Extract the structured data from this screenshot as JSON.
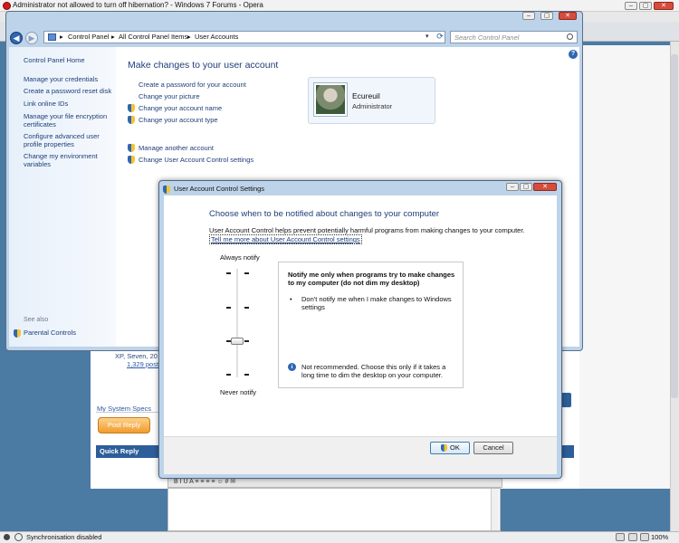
{
  "browser": {
    "title": "Administrator not allowed to turn off hibernation? - Windows 7 Forums - Opera",
    "status_text": "Synchronisation disabled",
    "zoom": "100%",
    "min_glyph": "–",
    "max_glyph": "▢",
    "close_glyph": "✕"
  },
  "forum": {
    "xp_text": "XP, Seven, 20",
    "posts_text": "1,329 post",
    "system_specs": "My System Specs",
    "post_reply": "Post Reply",
    "quick_reply": "Quick Reply",
    "editor_toolbar": "B  I  U  A  ≡ ≡ ≡ ≡  ☺  #  ✉"
  },
  "control_panel": {
    "breadcrumb": [
      "Control Panel",
      "All Control Panel Items",
      "User Accounts"
    ],
    "crumb_separator": "▸",
    "search_placeholder": "Search Control Panel",
    "sidebar_home": "Control Panel Home",
    "sidebar_links": [
      "Manage your credentials",
      "Create a password reset disk",
      "Link online IDs",
      "Manage your file encryption certificates",
      "Configure advanced user profile properties",
      "Change my environment variables"
    ],
    "see_also": "See also",
    "parental_controls": "Parental Controls",
    "heading": "Make changes to your user account",
    "tasks": [
      "Create a password for your account",
      "Change your picture",
      "Change your account name",
      "Change your account type",
      "Manage another account",
      "Change User Account Control settings"
    ],
    "user_name": "Ecureuil",
    "user_role": "Administrator"
  },
  "uac": {
    "title": "User Account Control Settings",
    "heading": "Choose when to be notified about changes to your computer",
    "description": "User Account Control helps prevent potentially harmful programs from making changes to your computer.",
    "tell_more": "Tell me more about User Account Control settings",
    "always_notify": "Always notify",
    "never_notify": "Never notify",
    "slider_level": "3 of 4",
    "box_title": "Notify me only when programs try to make changes to my computer (do not dim my desktop)",
    "bullet": "Don't notify me when I make changes to Windows settings",
    "note": "Not recommended. Choose this only if it takes a long time to dim the desktop on your computer.",
    "ok": "OK",
    "cancel": "Cancel"
  }
}
